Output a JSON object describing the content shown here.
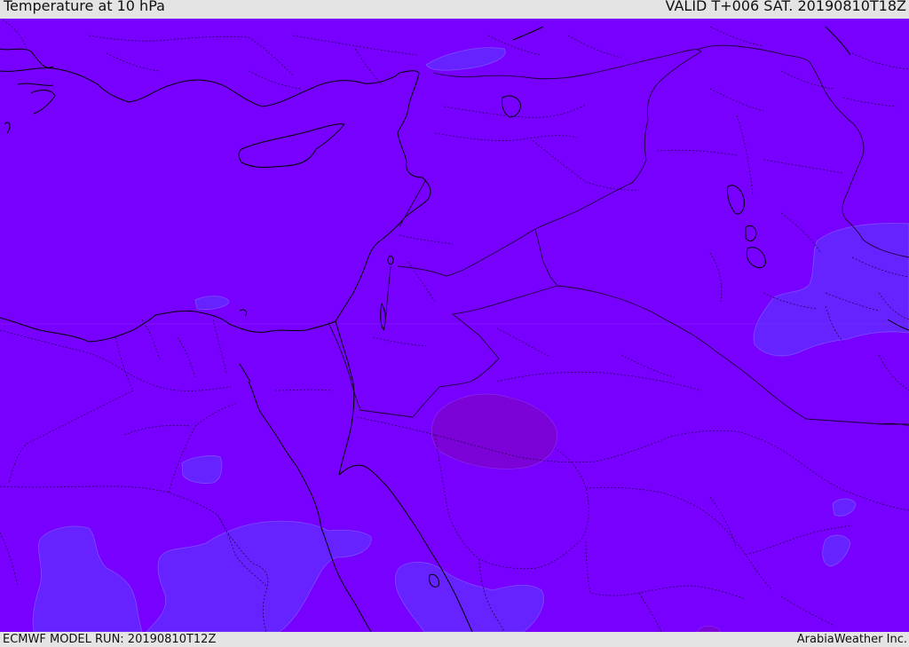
{
  "header": {
    "title": "Temperature at 10 hPa",
    "valid_time": "VALID T+006 SAT. 20190810T18Z"
  },
  "footer": {
    "model_run": "ECMWF MODEL RUN: 20190810T12Z",
    "credit": "ArabiaWeather Inc."
  },
  "colors": {
    "field_base": "#7800ff",
    "field_warm_patch": "#7c03d8",
    "field_cool_patch": "#6623ff",
    "coastline": "#000000",
    "country_border": "#3a1066"
  }
}
